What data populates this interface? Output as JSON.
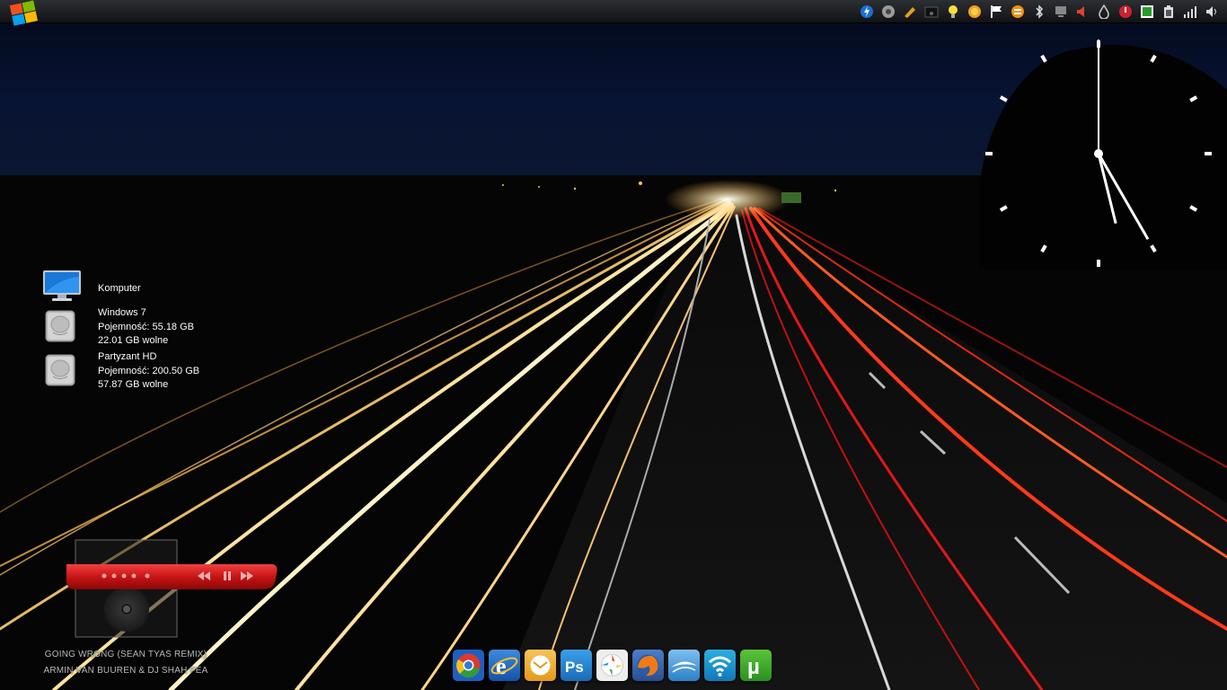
{
  "desktop": {
    "items": [
      {
        "name": "Komputer",
        "lines": []
      },
      {
        "name": "Windows 7",
        "lines": [
          "Pojemność: 55.18 GB",
          "22.01 GB wolne"
        ]
      },
      {
        "name": "Partyzant HD",
        "lines": [
          "Pojemność: 200.50 GB",
          "57.87 GB wolne"
        ]
      }
    ]
  },
  "media_player": {
    "track": "GOING WRONG (SEAN TYAS REMIX)",
    "artist": "ARMIN VAN BUUREN & DJ SHAH FEA"
  },
  "clock": {
    "hour": 5,
    "minute": 0
  },
  "tray_icons": [
    "lightning-icon",
    "disc-icon",
    "pencil-icon",
    "camera-icon",
    "bulb-icon",
    "sun-icon",
    "flag-icon",
    "equals-icon",
    "bluetooth-icon",
    "monitor-icon",
    "speaker-icon",
    "drop-icon",
    "power-icon",
    "torrent-icon",
    "battery-icon",
    "signal-icon",
    "volume-icon"
  ],
  "dock_icons": [
    "chrome-icon",
    "internet-explorer-icon",
    "mail-icon",
    "photoshop-icon",
    "picasa-icon",
    "firefox-icon",
    "stardock-icon",
    "wifi-icon",
    "utorrent-icon"
  ],
  "colors": {
    "accent_red": "#d81e1e",
    "topbar": "#1e2023"
  }
}
